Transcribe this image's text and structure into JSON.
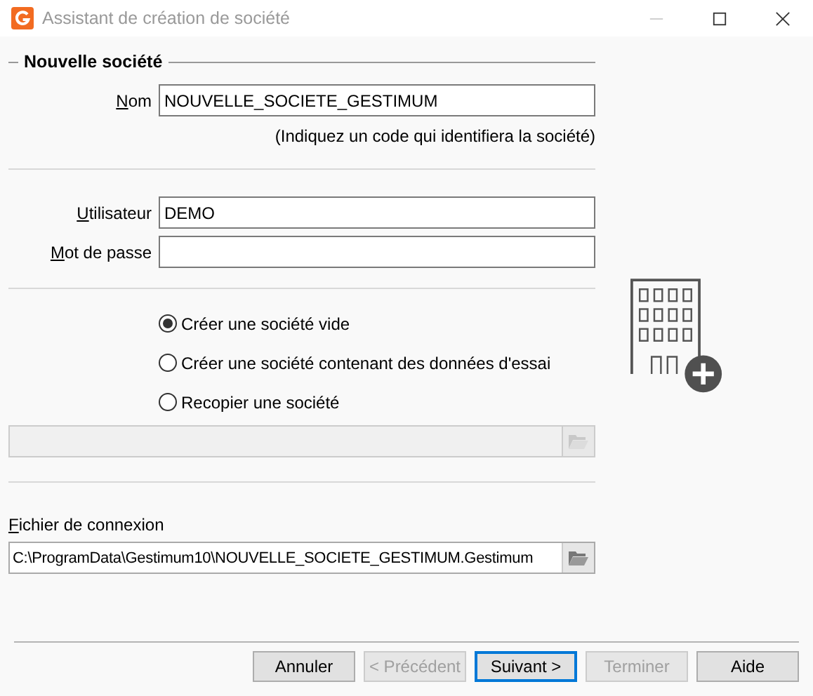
{
  "window": {
    "title": "Assistant de création de société"
  },
  "group": {
    "title": "Nouvelle société"
  },
  "name_field": {
    "label": {
      "key": "N",
      "rest": "om"
    },
    "value": "NOUVELLE_SOCIETE_GESTIMUM",
    "hint": "(Indiquez un code qui identifiera la société)"
  },
  "user_field": {
    "label": {
      "key": "U",
      "rest": "tilisateur"
    },
    "value": "DEMO"
  },
  "password_field": {
    "label": {
      "key": "M",
      "rest": "ot de passe"
    }
  },
  "options": [
    {
      "label": "Créer une société vide",
      "selected": true
    },
    {
      "label": "Créer une société contenant des données d'essai",
      "selected": false
    },
    {
      "label": "Recopier une société",
      "selected": false
    }
  ],
  "copy_path": {
    "disabled": true
  },
  "connection_file": {
    "label": {
      "key": "F",
      "rest": "ichier de connexion"
    },
    "value": "C:\\ProgramData\\Gestimum10\\NOUVELLE_SOCIETE_GESTIMUM.Gestimum"
  },
  "buttons": [
    {
      "label": "Annuler",
      "disabled": false,
      "default": false
    },
    {
      "label": "< Précédent",
      "disabled": true,
      "default": false
    },
    {
      "label": "Suivant >",
      "disabled": false,
      "default": true
    },
    {
      "label": "Terminer",
      "disabled": true,
      "default": false
    },
    {
      "label": "Aide",
      "disabled": false,
      "default": false
    }
  ]
}
